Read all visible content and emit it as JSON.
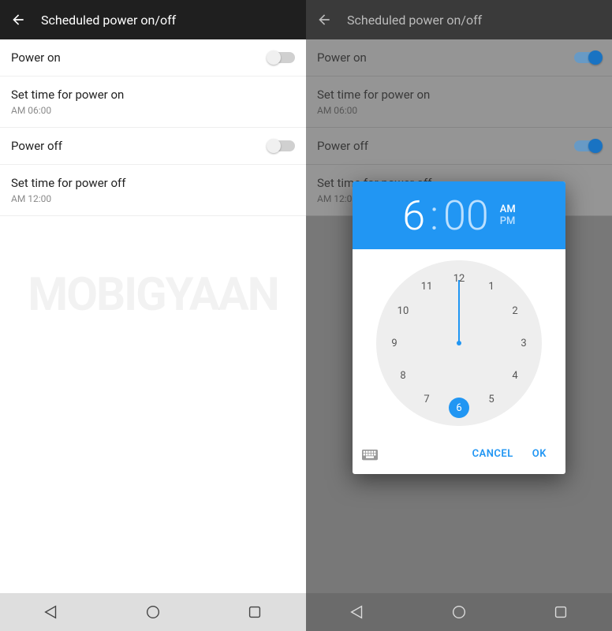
{
  "watermark": "MOBIGYAAN",
  "appbar": {
    "title": "Scheduled power on/off"
  },
  "settings": {
    "power_on": {
      "label": "Power on"
    },
    "set_on": {
      "label": "Set time for power on",
      "value": "AM 06:00"
    },
    "power_off": {
      "label": "Power off"
    },
    "set_off": {
      "label": "Set time for power off",
      "value": "AM 12:00"
    }
  },
  "dialog": {
    "hour": "6",
    "minute": "00",
    "am": "AM",
    "pm": "PM",
    "hours": [
      "12",
      "1",
      "2",
      "3",
      "4",
      "5",
      "6",
      "7",
      "8",
      "9",
      "10",
      "11"
    ],
    "selected_hour": "6",
    "cancel": "CANCEL",
    "ok": "OK"
  }
}
